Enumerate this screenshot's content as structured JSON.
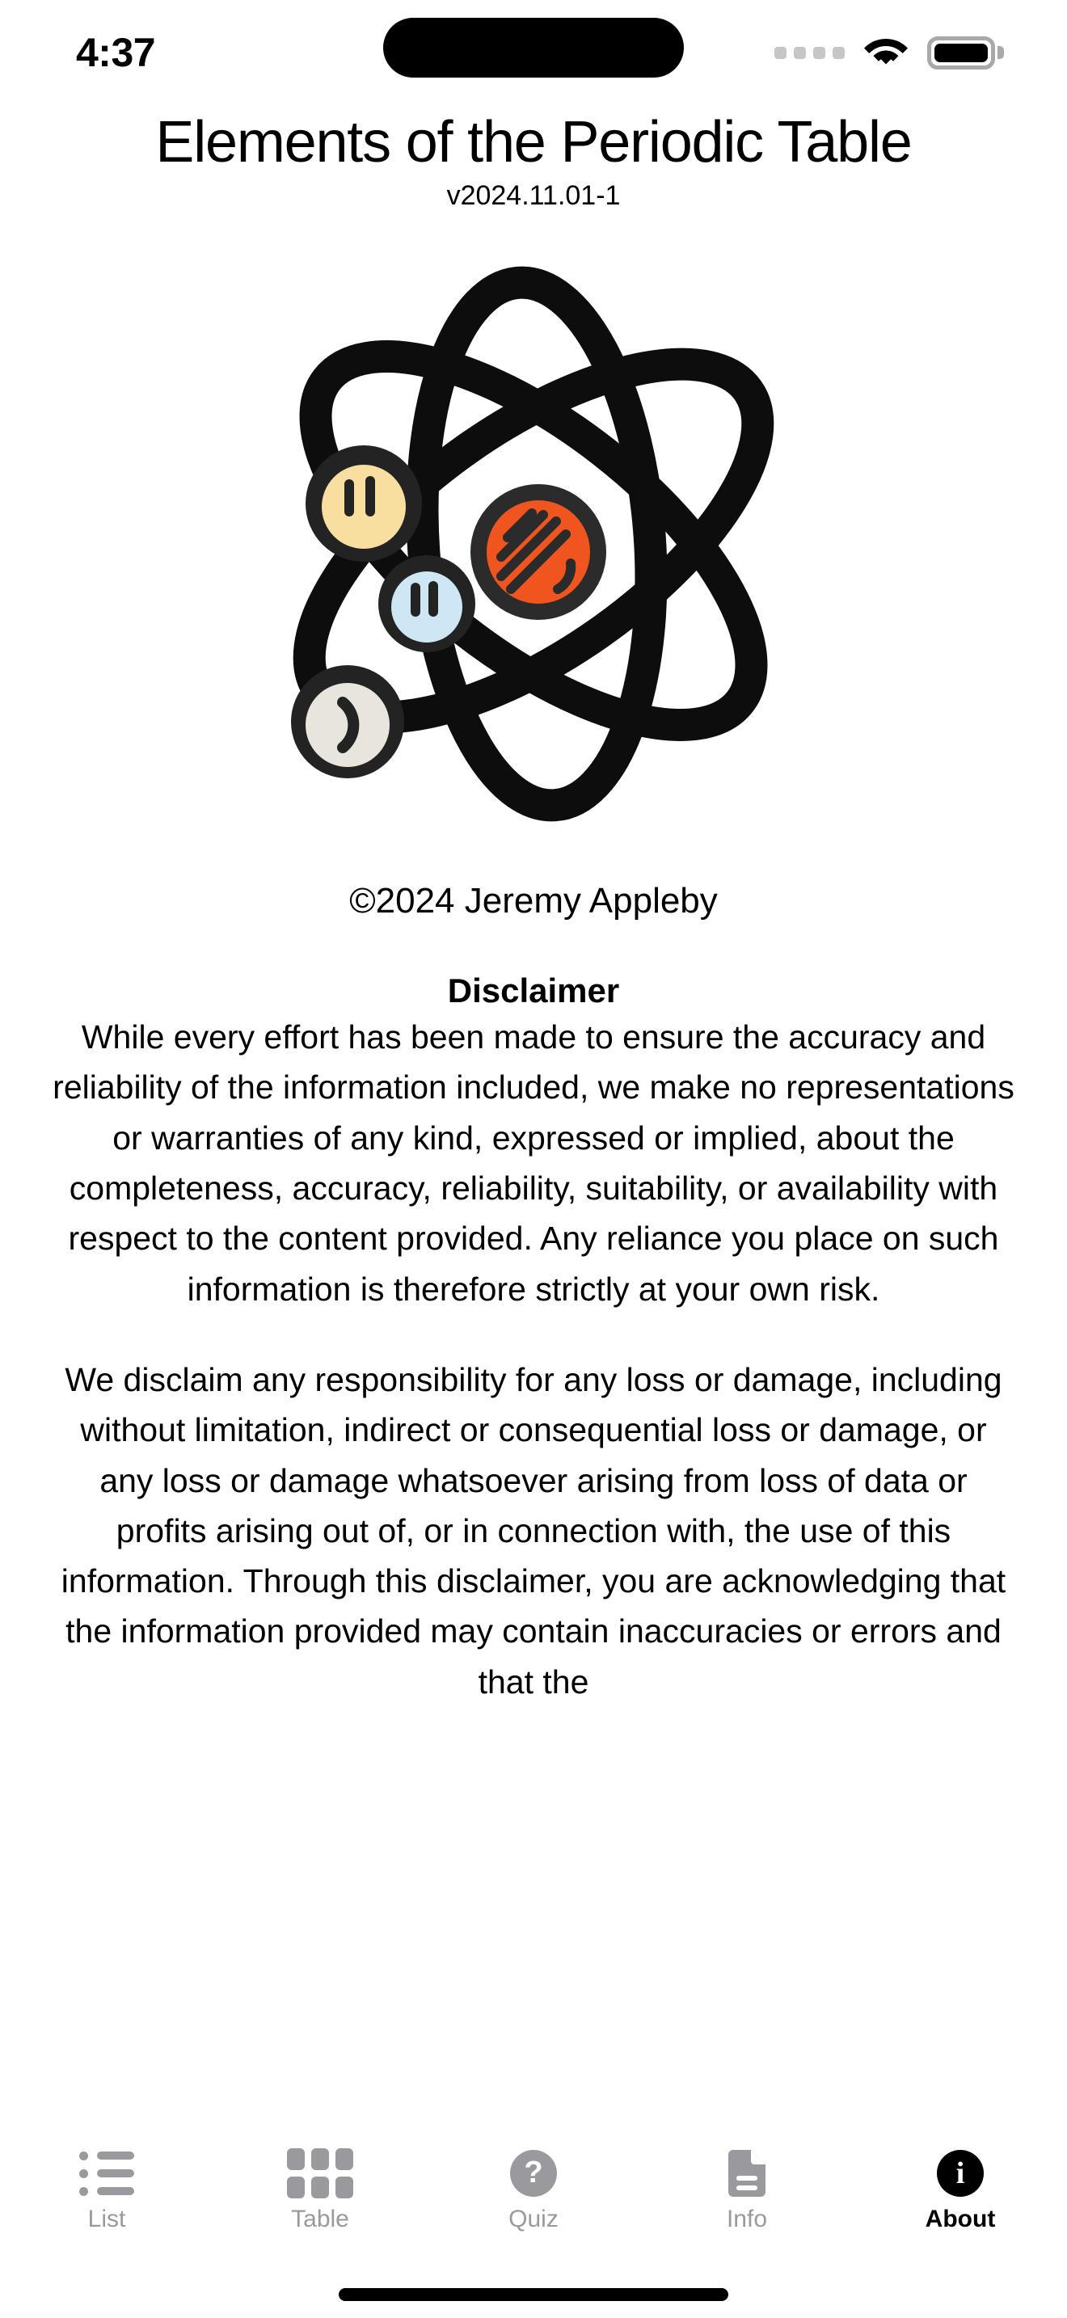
{
  "status_bar": {
    "time": "4:37",
    "cellular_icon": "cellular-dots-icon",
    "wifi_icon": "wifi-icon",
    "battery_icon": "battery-full-icon"
  },
  "header": {
    "title": "Elements of the Periodic Table",
    "version": "v2024.11.01-1"
  },
  "logo": {
    "name": "atom-logo",
    "nucleus_color": "#F0551F",
    "electron_colors": [
      "#F8DFA0",
      "#CFE7F5",
      "#E8E5DC"
    ],
    "orbit_color": "#000000"
  },
  "about": {
    "copyright": "©2024 Jeremy Appleby",
    "disclaimer_heading": "Disclaimer",
    "paragraphs": [
      "While every effort has been made to ensure the accuracy and reliability of the information included, we make no representations or warranties of any kind, expressed or implied, about the completeness, accuracy, reliability, suitability, or availability with respect to the content provided. Any reliance you place on such information is therefore strictly at your own risk.",
      "We disclaim any responsibility for any loss or damage, including without limitation, indirect or consequential loss or damage, or any loss or damage whatsoever arising from loss of data or profits arising out of, or in connection with, the use of this information. Through this disclaimer, you are acknowledging that the information provided may contain inaccuracies or errors and that the"
    ]
  },
  "tab_bar": {
    "active_tab": "About",
    "tabs": [
      {
        "label": "List",
        "icon": "list-icon"
      },
      {
        "label": "Table",
        "icon": "grid-icon"
      },
      {
        "label": "Quiz",
        "icon": "question-mark-circle-icon"
      },
      {
        "label": "Info",
        "icon": "document-icon"
      },
      {
        "label": "About",
        "icon": "info-circle-icon"
      }
    ]
  },
  "colors": {
    "inactive_tab": "#9a9a9e",
    "active_tab": "#000000",
    "background": "#ffffff"
  }
}
